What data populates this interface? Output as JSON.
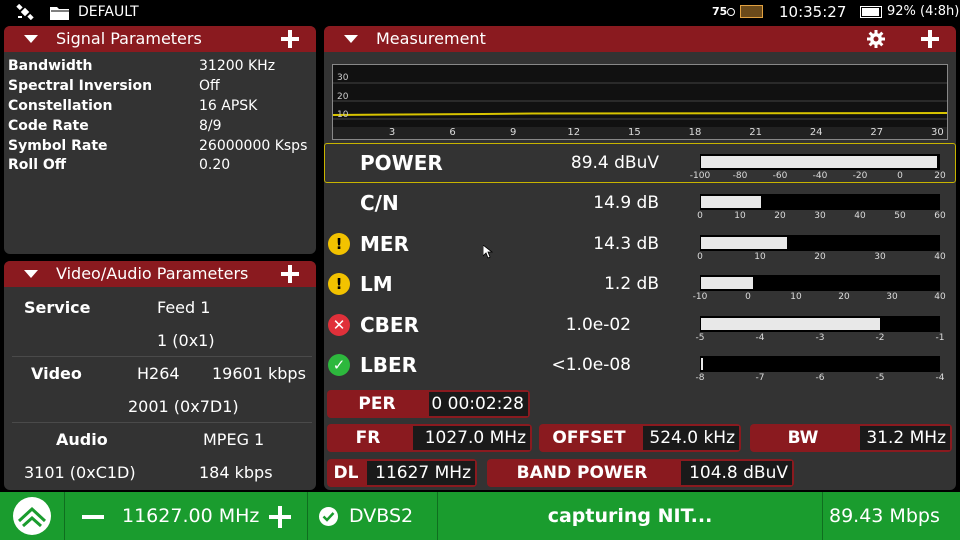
{
  "status": {
    "profile": "DEFAULT",
    "temperature": "75",
    "time": "10:35:27",
    "battery": "92% (4:8h)",
    "battery_level_pct": 92
  },
  "signal_parameters": {
    "title": "Signal Parameters",
    "rows": [
      {
        "label": "Bandwidth",
        "value": "31200 KHz"
      },
      {
        "label": "Spectral Inversion",
        "value": "Off"
      },
      {
        "label": "Constellation",
        "value": "16 APSK"
      },
      {
        "label": "Code Rate",
        "value": "8/9"
      },
      {
        "label": "Symbol Rate",
        "value": "26000000 Ksps"
      },
      {
        "label": "Roll Off",
        "value": "0.20"
      }
    ]
  },
  "video_audio": {
    "title": "Video/Audio Parameters",
    "service_label": "Service",
    "service_name": "Feed 1",
    "service_id": "1 (0x1)",
    "video_label": "Video",
    "video_codec": "H264",
    "video_rate": "19601 kbps",
    "video_pid": "2001 (0x7D1)",
    "audio_label": "Audio",
    "audio_codec": "MPEG 1",
    "audio_pid": "3101 (0xC1D)",
    "audio_rate": "184 kbps"
  },
  "measurement": {
    "title": "Measurement",
    "graph": {
      "y_ticks": [
        "30",
        "20",
        "10"
      ],
      "x_ticks": [
        "3",
        "6",
        "9",
        "12",
        "15",
        "18",
        "21",
        "24",
        "27",
        "30"
      ]
    },
    "rows": [
      {
        "name": "POWER",
        "value": "89.4 dBuV",
        "fill": 0.99,
        "scale": [
          "-100",
          "-80",
          "-60",
          "-40",
          "-20",
          "0",
          "20"
        ],
        "status": ""
      },
      {
        "name": "C/N",
        "value": "14.9 dB",
        "fill": 0.25,
        "scale": [
          "0",
          "10",
          "20",
          "30",
          "40",
          "50",
          "60"
        ],
        "status": ""
      },
      {
        "name": "MER",
        "value": "14.3 dB",
        "fill": 0.36,
        "scale": [
          "0",
          "10",
          "20",
          "30",
          "40"
        ],
        "status": "warning"
      },
      {
        "name": "LM",
        "value": "1.2 dB",
        "fill": 0.22,
        "scale": [
          "-10",
          "0",
          "10",
          "20",
          "30",
          "40"
        ],
        "status": "warning"
      },
      {
        "name": "CBER",
        "value": "1.0e-02",
        "fill": 0.75,
        "scale": [
          "-5",
          "-4",
          "-3",
          "-2",
          "-1"
        ],
        "status": "error"
      },
      {
        "name": "LBER",
        "value": "<1.0e-08",
        "fill": 0.0,
        "scale": [
          "-8",
          "-7",
          "-6",
          "-5",
          "-4"
        ],
        "status": "ok"
      }
    ],
    "per_label": "PER",
    "per_value": "0 00:02:28",
    "fr_label": "FR",
    "fr_value": "1027.0 MHz",
    "offset_label": "OFFSET",
    "offset_value": "524.0 kHz",
    "bw_label": "BW",
    "bw_value": "31.2 MHz",
    "dl_label": "DL",
    "dl_value": "11627 MHz",
    "band_power_label": "BAND POWER",
    "band_power_value": "104.8 dBuV"
  },
  "bottom": {
    "frequency": "11627.00 MHz",
    "standard": "DVBS2",
    "message": "capturing NIT...",
    "bitrate": "89.43 Mbps"
  },
  "colors": {
    "header_red": "#8a1a1f",
    "panel_gray": "#333333",
    "bottom_green": "#1a9c2e",
    "warning_yellow": "#f2c200",
    "error_red": "#e0303a",
    "ok_green": "#2db83d"
  }
}
